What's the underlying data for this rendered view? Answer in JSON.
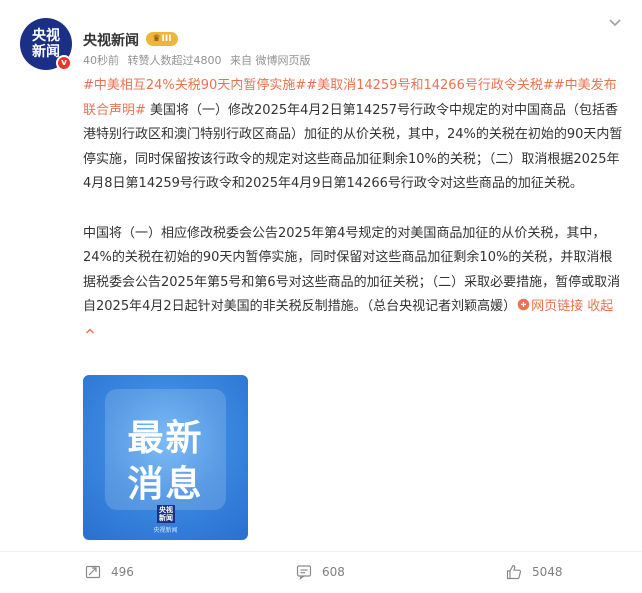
{
  "author": {
    "avatar_line1": "央视",
    "avatar_line2": "新闻",
    "name": "央视新闻",
    "vip_label": "III",
    "verified_mark": "v"
  },
  "meta": {
    "time": "40秒前",
    "reposts_summary": "转赞人数超过4800",
    "source": "来自 微博网页版"
  },
  "post": {
    "tag1": "#中美相互24%关税90天内暂停实施#",
    "tag2": "#美取消14259号和14266号行政令关税#",
    "tag3": "#中美发布联合声明#",
    "para1_text": " 美国将（一）修改2025年4月2日第14257号行政令中规定的对中国商品（包括香港特别行政区和澳门特别行政区商品）加征的从价关税，其中，24%的关税在初始的90天内暂停实施，同时保留按该行政令的规定对这些商品加征剩余10%的关税；（二）取消根据2025年4月8日第14259号行政令和2025年4月9日第14266号行政令对这些商品的加征关税。",
    "para2_text": "中国将（一）相应修改税委会公告2025年第4号规定的对美国商品加征的从价关税，其中，24%的关税在初始的90天内暂停实施，同时保留对这些商品加征剩余10%的关税，并取消根据税委会公告2025年第5号和第6号对这些商品的加征关税；（二）采取必要措施，暂停或取消自2025年4月2日起针对美国的非关税反制措施。（总台央视记者刘颖高媛）",
    "link_label": "网页链接",
    "collapse_label": "收起"
  },
  "image": {
    "line1": "最新",
    "line2": "消息",
    "logo_line1": "央视",
    "logo_line2": "新闻",
    "watermark": "央视新闻"
  },
  "actions": {
    "repost_count": "496",
    "comment_count": "608",
    "like_count": "5048"
  },
  "colors": {
    "accent": "#eb7350",
    "avatar_bg": "#1b2f86",
    "vip_bg": "#f0b43a",
    "image_blue": "#3a88e0"
  },
  "icons": {
    "more": "chevron-down-icon",
    "repost": "repost-icon",
    "comment": "comment-icon",
    "like": "thumbs-up-icon",
    "link": "link-icon"
  }
}
